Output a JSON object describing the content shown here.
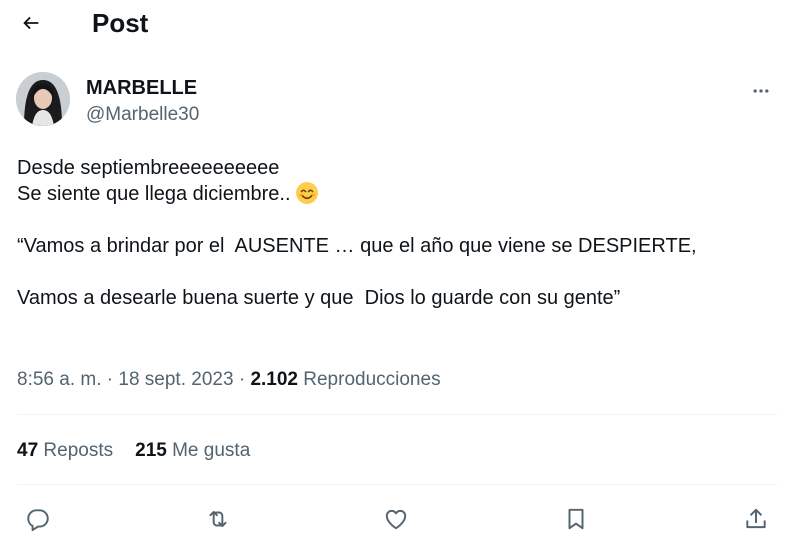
{
  "header": {
    "title": "Post",
    "back_icon": "arrow-left-icon"
  },
  "author": {
    "display_name": "MARBELLE",
    "handle": "@Marbelle30",
    "avatar_icon": "profile-avatar"
  },
  "post": {
    "lines": [
      "Desde septiembreeeeeeeeee",
      "Se siente que llega diciembre..",
      "",
      "“Vamos a brindar por el  AUSENTE … que el año que viene se DESPIERTE,",
      "",
      "Vamos a desearle buena suerte y que  Dios lo guarde con su gente”"
    ],
    "emoji": "smiling-face-with-smiling-eyes"
  },
  "meta": {
    "time": "8:56 a. m.",
    "separator": "·",
    "date": "18 sept. 2023",
    "views_count": "2.102",
    "views_label": "Reproducciones"
  },
  "stats": {
    "reposts_count": "47",
    "reposts_label": "Reposts",
    "likes_count": "215",
    "likes_label": "Me gusta"
  },
  "actions": [
    "reply-icon",
    "repost-icon",
    "like-icon",
    "bookmark-icon",
    "share-icon"
  ],
  "colors": {
    "text": "#0f1419",
    "secondary": "#536471",
    "divider": "#eff3f4"
  }
}
